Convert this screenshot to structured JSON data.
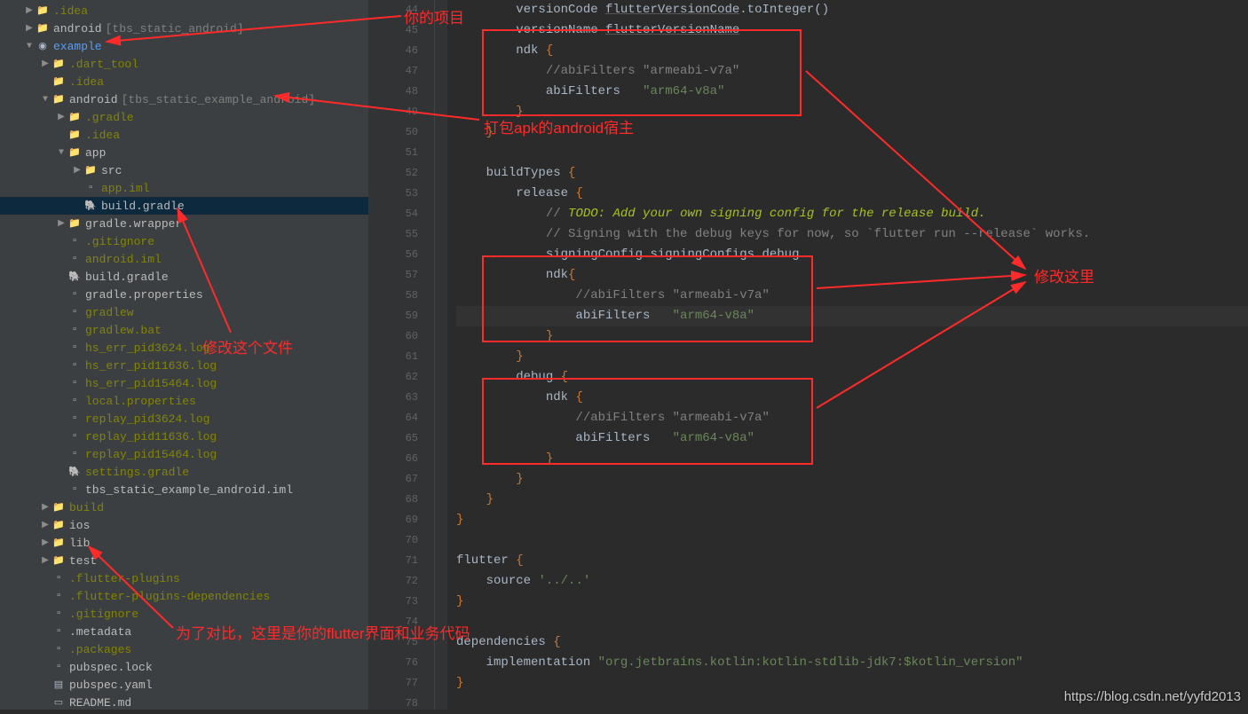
{
  "tree": [
    {
      "depth": 1,
      "arrow": "▶",
      "icon": "folder",
      "label": ".idea",
      "cls": "dim"
    },
    {
      "depth": 1,
      "arrow": "▶",
      "icon": "folder",
      "label": "android",
      "suffix": "[tbs_static_android]",
      "cls": ""
    },
    {
      "depth": 1,
      "arrow": "▼",
      "icon": "flutter",
      "label": "example",
      "cls": "teal"
    },
    {
      "depth": 2,
      "arrow": "▶",
      "icon": "folder",
      "label": ".dart_tool",
      "cls": "dim"
    },
    {
      "depth": 2,
      "arrow": "",
      "icon": "folder",
      "label": ".idea",
      "cls": "dim"
    },
    {
      "depth": 2,
      "arrow": "▼",
      "icon": "folder",
      "label": "android",
      "suffix": "[tbs_static_example_android]",
      "cls": ""
    },
    {
      "depth": 3,
      "arrow": "▶",
      "icon": "folder",
      "label": ".gradle",
      "cls": "dim"
    },
    {
      "depth": 3,
      "arrow": "",
      "icon": "folder",
      "label": ".idea",
      "cls": "dim"
    },
    {
      "depth": 3,
      "arrow": "▼",
      "icon": "folder",
      "label": "app",
      "cls": ""
    },
    {
      "depth": 4,
      "arrow": "▶",
      "icon": "folder",
      "label": "src",
      "cls": ""
    },
    {
      "depth": 4,
      "arrow": "",
      "icon": "file",
      "label": "app.iml",
      "cls": "dim"
    },
    {
      "depth": 4,
      "arrow": "",
      "icon": "gradle",
      "label": "build.gradle",
      "cls": "",
      "selected": true
    },
    {
      "depth": 3,
      "arrow": "▶",
      "icon": "folder",
      "label": "gradle.wrapper",
      "cls": ""
    },
    {
      "depth": 3,
      "arrow": "",
      "icon": "file",
      "label": ".gitignore",
      "cls": "dim"
    },
    {
      "depth": 3,
      "arrow": "",
      "icon": "file",
      "label": "android.iml",
      "cls": "dim"
    },
    {
      "depth": 3,
      "arrow": "",
      "icon": "gradle",
      "label": "build.gradle",
      "cls": ""
    },
    {
      "depth": 3,
      "arrow": "",
      "icon": "file",
      "label": "gradle.properties",
      "cls": ""
    },
    {
      "depth": 3,
      "arrow": "",
      "icon": "file",
      "label": "gradlew",
      "cls": "dim"
    },
    {
      "depth": 3,
      "arrow": "",
      "icon": "file",
      "label": "gradlew.bat",
      "cls": "dim"
    },
    {
      "depth": 3,
      "arrow": "",
      "icon": "file",
      "label": "hs_err_pid3624.log",
      "cls": "dim"
    },
    {
      "depth": 3,
      "arrow": "",
      "icon": "file",
      "label": "hs_err_pid11636.log",
      "cls": "dim"
    },
    {
      "depth": 3,
      "arrow": "",
      "icon": "file",
      "label": "hs_err_pid15464.log",
      "cls": "dim"
    },
    {
      "depth": 3,
      "arrow": "",
      "icon": "file",
      "label": "local.properties",
      "cls": "dim"
    },
    {
      "depth": 3,
      "arrow": "",
      "icon": "file",
      "label": "replay_pid3624.log",
      "cls": "dim"
    },
    {
      "depth": 3,
      "arrow": "",
      "icon": "file",
      "label": "replay_pid11636.log",
      "cls": "dim"
    },
    {
      "depth": 3,
      "arrow": "",
      "icon": "file",
      "label": "replay_pid15464.log",
      "cls": "dim"
    },
    {
      "depth": 3,
      "arrow": "",
      "icon": "gradle",
      "label": "settings.gradle",
      "cls": "dim"
    },
    {
      "depth": 3,
      "arrow": "",
      "icon": "file",
      "label": "tbs_static_example_android.iml",
      "cls": ""
    },
    {
      "depth": 2,
      "arrow": "▶",
      "icon": "folder",
      "label": "build",
      "cls": "dim"
    },
    {
      "depth": 2,
      "arrow": "▶",
      "icon": "folder",
      "label": "ios",
      "cls": ""
    },
    {
      "depth": 2,
      "arrow": "▶",
      "icon": "folder",
      "label": "lib",
      "cls": ""
    },
    {
      "depth": 2,
      "arrow": "▶",
      "icon": "folder",
      "label": "test",
      "cls": ""
    },
    {
      "depth": 2,
      "arrow": "",
      "icon": "file",
      "label": ".flutter-plugins",
      "cls": "dim"
    },
    {
      "depth": 2,
      "arrow": "",
      "icon": "file",
      "label": ".flutter-plugins-dependencies",
      "cls": "dim"
    },
    {
      "depth": 2,
      "arrow": "",
      "icon": "file",
      "label": ".gitignore",
      "cls": "dim"
    },
    {
      "depth": 2,
      "arrow": "",
      "icon": "file",
      "label": ".metadata",
      "cls": ""
    },
    {
      "depth": 2,
      "arrow": "",
      "icon": "file",
      "label": ".packages",
      "cls": "dim"
    },
    {
      "depth": 2,
      "arrow": "",
      "icon": "file",
      "label": "pubspec.lock",
      "cls": ""
    },
    {
      "depth": 2,
      "arrow": "",
      "icon": "yaml",
      "label": "pubspec.yaml",
      "cls": ""
    },
    {
      "depth": 2,
      "arrow": "",
      "icon": "md",
      "label": "README.md",
      "cls": ""
    }
  ],
  "gutter_start": 44,
  "gutter_end": 78,
  "code_lines": [
    {
      "n": 44,
      "html": "        <span class='ident'>versionCode</span> <span class='udl'>flutterVersionCode</span>.toInteger()"
    },
    {
      "n": 45,
      "html": "        <span class='ident'>versionName</span> <span class='udl'>flutterVersionName</span>"
    },
    {
      "n": 46,
      "html": "        <span class='ident'>ndk</span> <span class='kw'>{</span>"
    },
    {
      "n": 47,
      "html": "            <span class='comment'>//abiFilters \"armeabi-v7a\"</span>"
    },
    {
      "n": 48,
      "html": "            <span class='ident'>abiFilters</span>   <span class='str'>\"arm64-v8a\"</span>"
    },
    {
      "n": 49,
      "html": "        <span class='kw'>}</span>"
    },
    {
      "n": 50,
      "html": "    <span class='kw'>}</span>"
    },
    {
      "n": 51,
      "html": ""
    },
    {
      "n": 52,
      "html": "    <span class='ident'>buildTypes</span> <span class='kw'>{</span>"
    },
    {
      "n": 53,
      "html": "        <span class='ident'>release</span> <span class='kw'>{</span>"
    },
    {
      "n": 54,
      "html": "            <span class='comment'>// </span><span class='todo'>TODO: Add your own signing config for the release build.</span>"
    },
    {
      "n": 55,
      "html": "            <span class='comment'>// Signing with the debug keys for now, so `flutter run --release` works.</span>"
    },
    {
      "n": 56,
      "html": "            <span class='ident'>signingConfig signingConfigs.debug</span>"
    },
    {
      "n": 57,
      "html": "            <span class='ident'>ndk</span><span class='kw'>{</span>"
    },
    {
      "n": 58,
      "html": "                <span class='comment'>//abiFilters \"armeabi-v7a\"</span>"
    },
    {
      "n": 59,
      "html": "<span class='caret-bg'></span>                <span class='ident'>abiFilters</span>   <span class='str'>\"arm64-v8a\"</span>",
      "caret": true
    },
    {
      "n": 60,
      "html": "            <span class='kw'>}</span>"
    },
    {
      "n": 61,
      "html": "        <span class='kw'>}</span>"
    },
    {
      "n": 62,
      "html": "        <span class='ident'>debug</span> <span class='kw'>{</span>"
    },
    {
      "n": 63,
      "html": "            <span class='ident'>ndk</span> <span class='kw'>{</span>"
    },
    {
      "n": 64,
      "html": "                <span class='comment'>//abiFilters \"armeabi-v7a\"</span>"
    },
    {
      "n": 65,
      "html": "                <span class='ident'>abiFilters</span>   <span class='str'>\"arm64-v8a\"</span>"
    },
    {
      "n": 66,
      "html": "            <span class='kw'>}</span>"
    },
    {
      "n": 67,
      "html": "        <span class='kw'>}</span>"
    },
    {
      "n": 68,
      "html": "    <span class='kw'>}</span>"
    },
    {
      "n": 69,
      "html": "<span class='kw'>}</span>"
    },
    {
      "n": 70,
      "html": ""
    },
    {
      "n": 71,
      "html": "<span class='ident'>flutter</span> <span class='kw'>{</span>"
    },
    {
      "n": 72,
      "html": "    <span class='ident'>source</span> <span class='str'>'../..'</span>"
    },
    {
      "n": 73,
      "html": "<span class='kw'>}</span>"
    },
    {
      "n": 74,
      "html": ""
    },
    {
      "n": 75,
      "html": "<span class='ident'>dependencies</span> <span class='kw'>{</span>"
    },
    {
      "n": 76,
      "html": "    <span class='ident'>implementation</span> <span class='str'>\"org.jetbrains.kotlin:kotlin-stdlib-jdk7:$kotlin_version\"</span>"
    },
    {
      "n": 77,
      "html": "<span class='kw'>}</span>"
    },
    {
      "n": 78,
      "html": ""
    }
  ],
  "annotations": {
    "your_project": "你的项目",
    "apk_host": "打包apk的android宿主",
    "modify_file": "修改这个文件",
    "modify_here": "修改这里",
    "flutter_code": "为了对比，这里是你的flutter界面和业务代码",
    "watermark": "https://blog.csdn.net/yyfd2013"
  }
}
